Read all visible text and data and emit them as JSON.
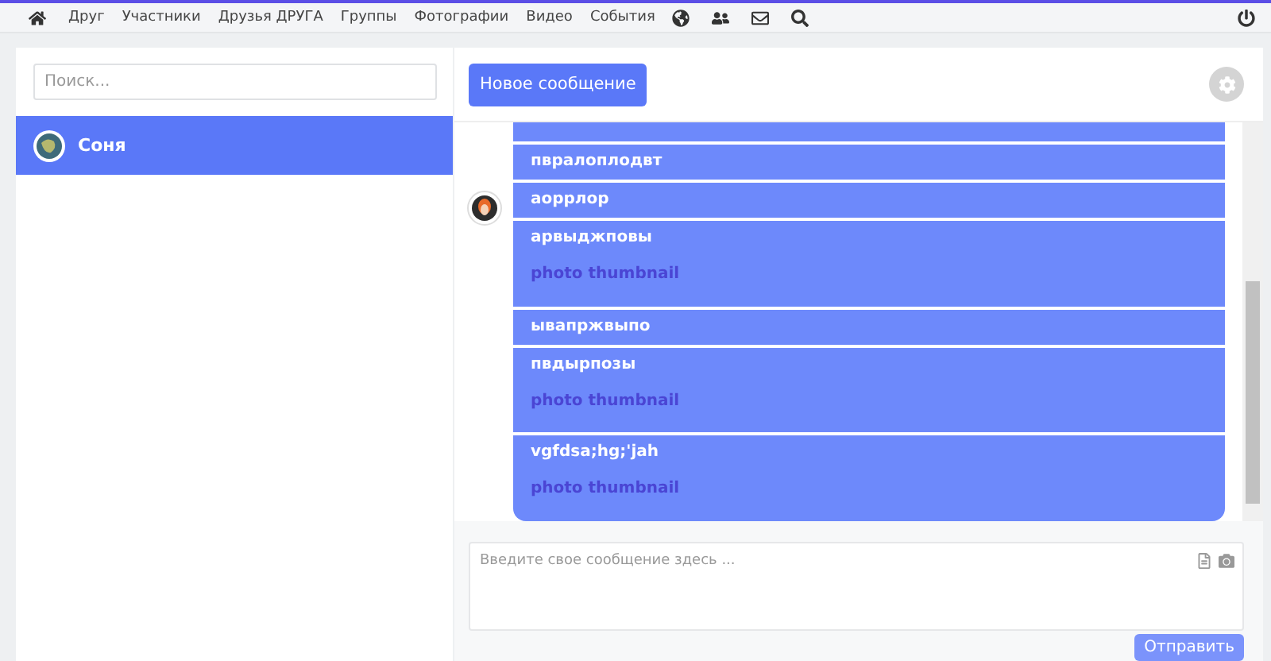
{
  "nav": {
    "items": [
      "Друг",
      "Участники",
      "Друзья ДРУГА",
      "Группы",
      "Фотографии",
      "Видео",
      "События"
    ]
  },
  "sidebar": {
    "search": {
      "placeholder": "Поиск..."
    },
    "contacts": [
      {
        "name": "Соня",
        "selected": true
      }
    ]
  },
  "chat": {
    "new_button": "Новое сообщение",
    "messages": [
      {
        "text": "пвралоплодвт"
      },
      {
        "text": "аоррлор"
      },
      {
        "text": "арвыджповы",
        "attachment": "photo thumbnail"
      },
      {
        "text": "ывапржвыпо"
      },
      {
        "text": "пвдырпозы",
        "attachment": "photo thumbnail"
      },
      {
        "text": "vgfdsa;hg;'jah",
        "attachment": "photo thumbnail"
      }
    ],
    "composer": {
      "placeholder": "Введите свое сообщение здесь ..."
    },
    "send_button": "Отправить"
  }
}
